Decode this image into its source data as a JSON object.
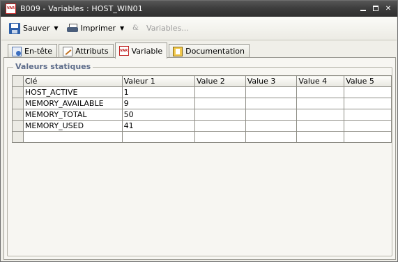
{
  "window": {
    "title": "B009 - Variables : HOST_WIN01",
    "icon": "var-icon",
    "controls": [
      "minimize",
      "maximize",
      "close"
    ]
  },
  "toolbar": {
    "save_label": "Sauver",
    "print_label": "Imprimer",
    "variables_label": "Variables..."
  },
  "tabs": [
    {
      "label": "En-tête",
      "icon": "header-icon",
      "active": false
    },
    {
      "label": "Attributs",
      "icon": "attributes-icon",
      "active": false
    },
    {
      "label": "Variable",
      "icon": "var-icon",
      "active": true
    },
    {
      "label": "Documentation",
      "icon": "book-icon",
      "active": false
    }
  ],
  "group": {
    "title": "Valeurs statiques"
  },
  "grid": {
    "columns": [
      "Clé",
      "Valeur 1",
      "Value 2",
      "Value 3",
      "Value 4",
      "Value 5"
    ],
    "rows": [
      [
        "HOST_ACTIVE",
        "1",
        "",
        "",
        "",
        ""
      ],
      [
        "MEMORY_AVAILABLE",
        "9",
        "",
        "",
        "",
        ""
      ],
      [
        "MEMORY_TOTAL",
        "50",
        "",
        "",
        "",
        ""
      ],
      [
        "MEMORY_USED",
        "41",
        "",
        "",
        "",
        ""
      ],
      [
        "",
        "",
        "",
        "",
        "",
        ""
      ]
    ]
  }
}
